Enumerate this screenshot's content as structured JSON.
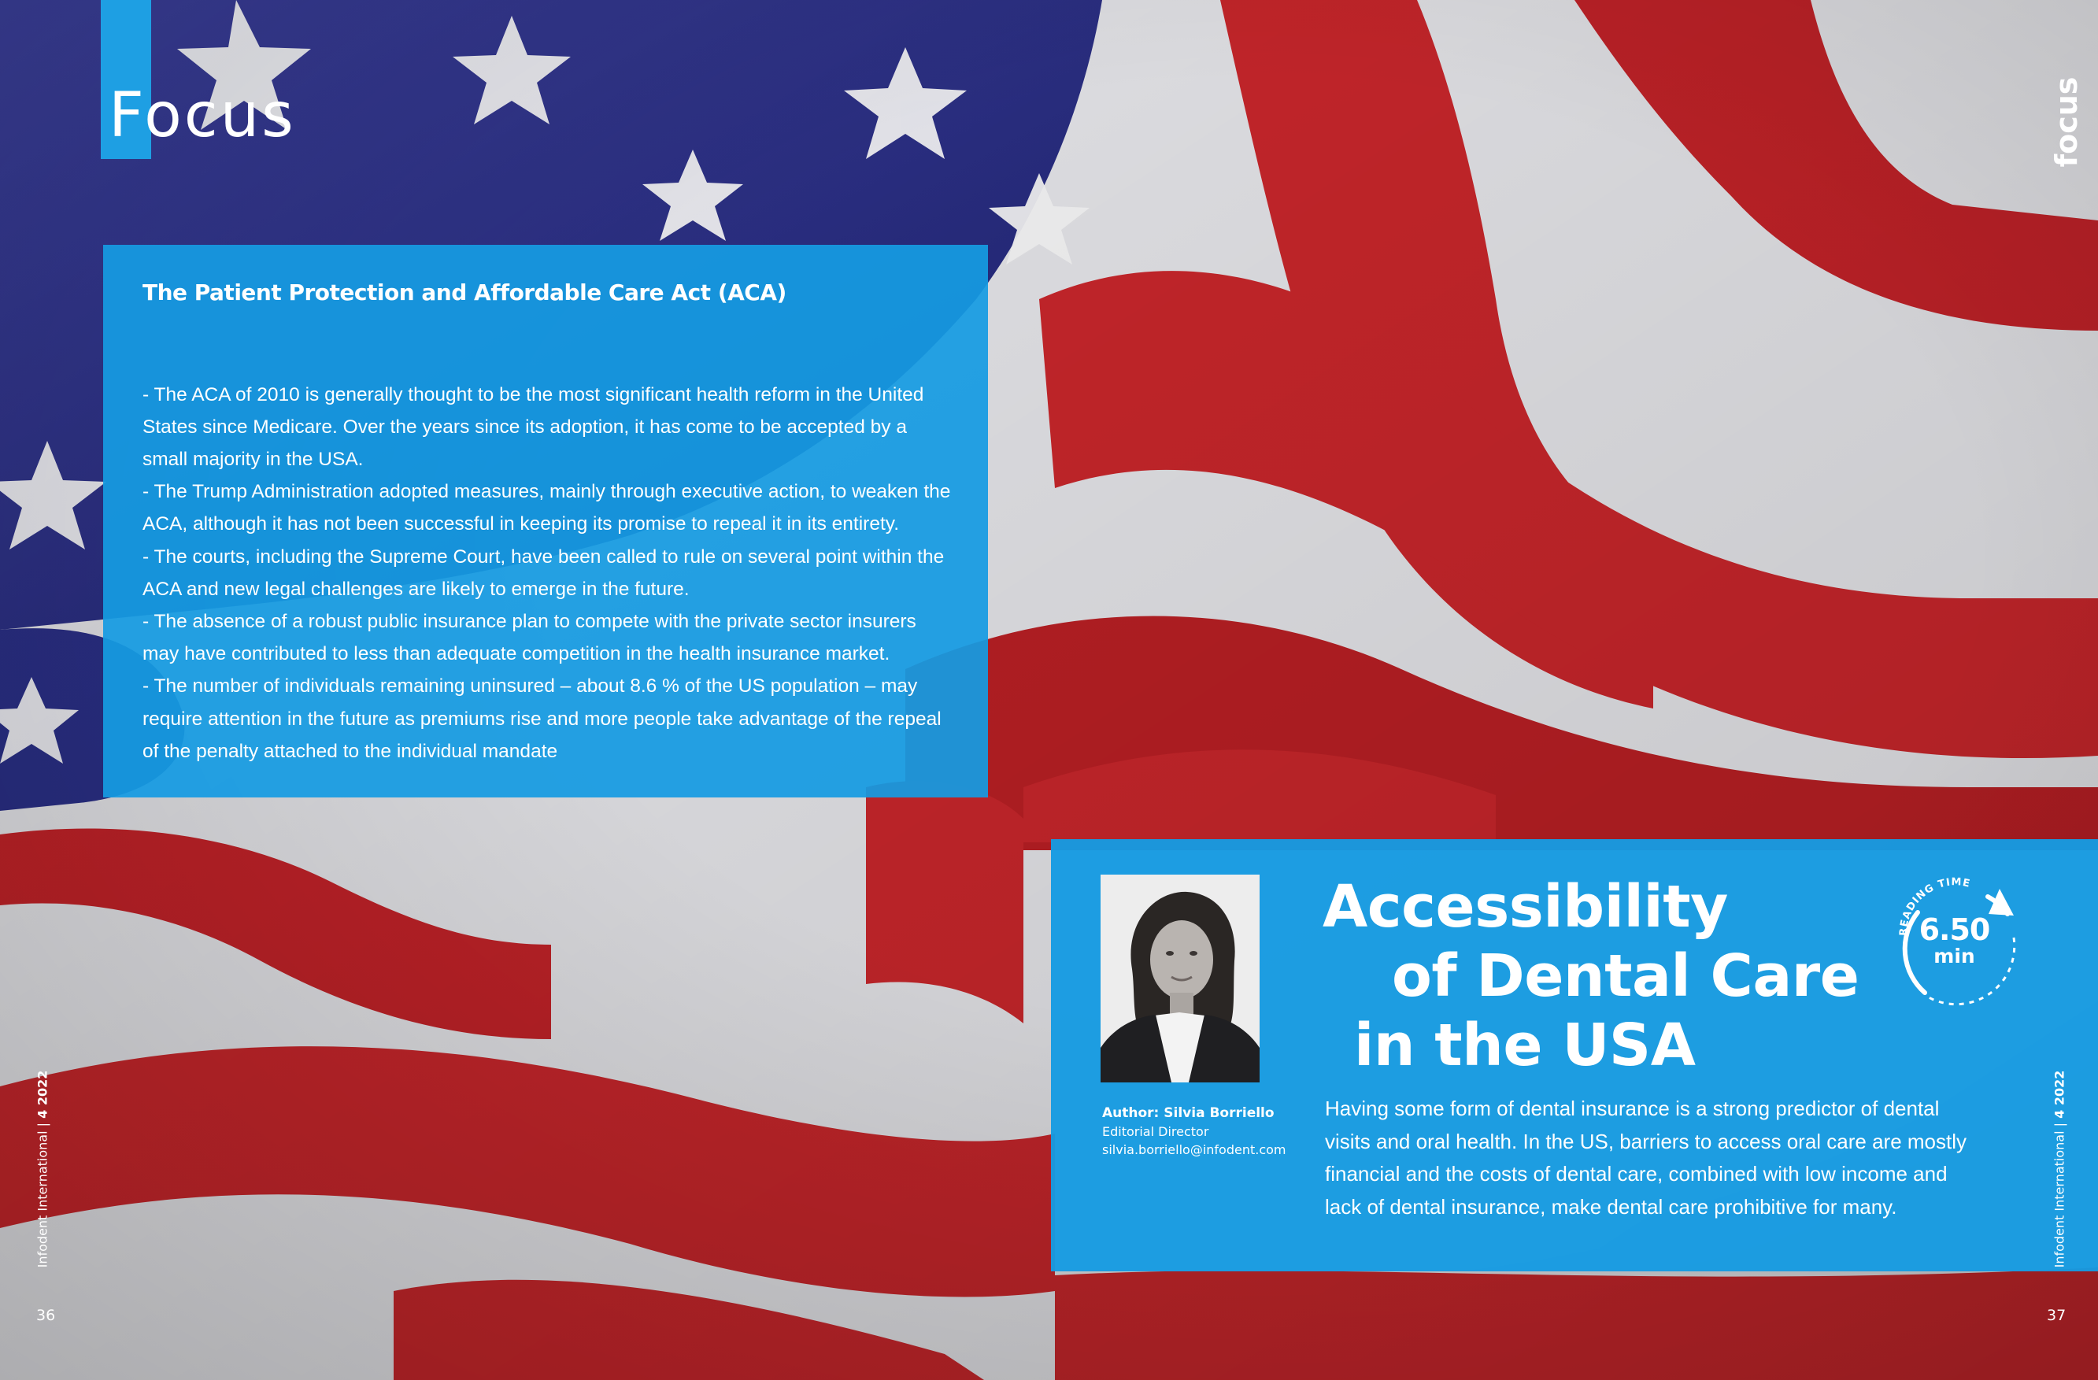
{
  "header": {
    "section_title": "Focus",
    "side_label": "focus"
  },
  "aca_box": {
    "title": "The Patient Protection and Affordable Care Act (ACA)",
    "points": [
      "- The ACA of 2010 is generally thought to be the most significant health reform in the United States since Medicare. Over the years since its adoption, it has come to be accepted by a small majority in the USA.",
      "- The Trump Administration adopted measures, mainly through executive action, to weaken the ACA, although it has not been successful in keeping its promise to repeal it in its entirety.",
      "- The courts, including the Supreme Court, have been called to rule on several point within the ACA and new legal challenges are likely to emerge in the future.",
      "- The absence of a robust public insurance plan to compete with the private sector insurers may have contributed to less than adequate competition in the health insurance market.",
      "- The number of individuals remaining uninsured – about 8.6 % of the US population – may require attention in the future as premiums rise and more people take advantage of the repeal of the penalty attached to the individual mandate"
    ]
  },
  "article": {
    "headline_lines": [
      "Accessibility",
      "of Dental Care",
      "in the USA"
    ],
    "lead": "Having some form of dental insurance is a strong predictor of dental visits and oral health. In the US, barriers to access oral care are mostly financial and the costs of dental care, combined with low income and lack of dental insurance, make dental care prohibitive for many.",
    "author_name": "Author: Silvia Borriello",
    "author_role": "Editorial Director",
    "author_email": "silvia.borriello@infodent.com",
    "reading_label": "READING TIME",
    "reading_value": "6.50",
    "reading_unit": "min"
  },
  "footer": {
    "journal": "Infodent International",
    "separator": "|",
    "issue": "4 2022",
    "page_left": "36",
    "page_right": "37"
  },
  "colors": {
    "box_blue": "#1e9fe3",
    "flag_red": "#c8262b",
    "flag_blue": "#2a2f86",
    "flag_white": "#ededf0"
  },
  "icons": {
    "reading_time": "circular-arrow-icon",
    "flag": "us-flag-background"
  }
}
